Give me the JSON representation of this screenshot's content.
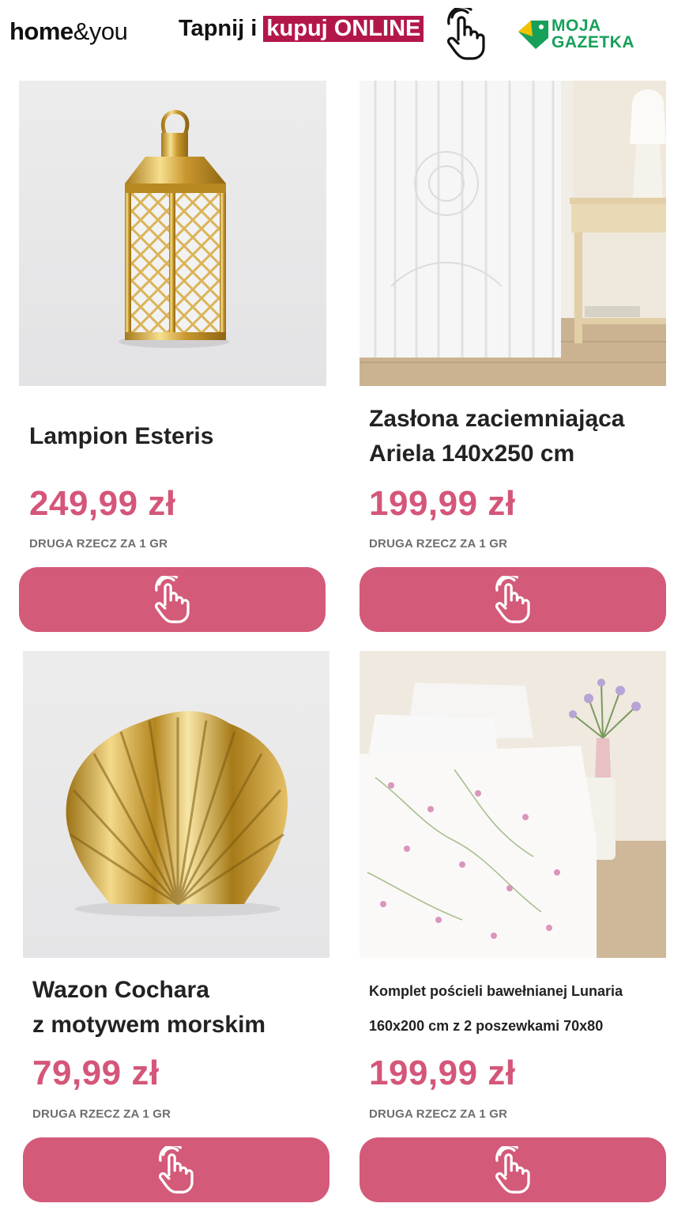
{
  "header": {
    "logo_home": "home",
    "logo_amp": "&",
    "logo_you": "you",
    "tap_text": "Tapnij i ",
    "tap_highlight": "kupuj ONLINE",
    "gazetka_line1": "MOJA",
    "gazetka_line2": "GAZETKA"
  },
  "products": [
    {
      "name_line1": "Lampion Esteris",
      "name_line2": "",
      "price": "249,99 zł",
      "promo": "DRUGA RZECZ ZA 1 GR",
      "image": "gold-lantern"
    },
    {
      "name_line1": "Zasłona zaciemniająca",
      "name_line2": "Ariela 140x250 cm",
      "price": "199,99 zł",
      "promo": "DRUGA RZECZ ZA 1 GR",
      "image": "white-lace-curtain"
    },
    {
      "name_line1": "Wazon Cochara",
      "name_line2": "z motywem morskim",
      "price": "79,99 zł",
      "promo": "DRUGA RZECZ ZA 1 GR",
      "image": "gold-shell-vase"
    },
    {
      "name_line1": "Komplet pościeli bawełnianej Lunaria",
      "name_line2": "160x200 cm z 2 poszewkami 70x80",
      "price": "199,99 zł",
      "promo": "DRUGA RZECZ ZA 1 GR",
      "image": "floral-bedding"
    }
  ],
  "colors": {
    "accent": "#d45a79",
    "price": "#d45679",
    "highlight": "#b3174a",
    "gazetka": "#17a05a"
  }
}
